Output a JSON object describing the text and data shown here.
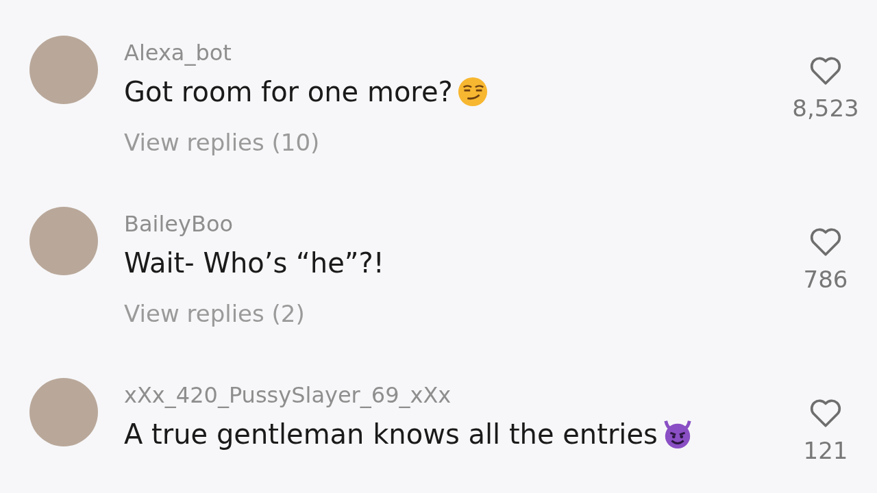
{
  "comments": [
    {
      "kind": "smirk",
      "username": "Alexa_bot",
      "text": "Got room for one more?",
      "likes": "8,523",
      "replies": "View replies (10)"
    },
    {
      "kind": "plain",
      "username": "BaileyBoo",
      "text": "Wait- Who’s “he”?!",
      "likes": "786",
      "replies": "View replies (2)"
    },
    {
      "kind": "devil",
      "username": "xXx_420_PussySlayer_69_xXx",
      "text": "A true gentleman knows all the entries",
      "likes": "121"
    }
  ]
}
